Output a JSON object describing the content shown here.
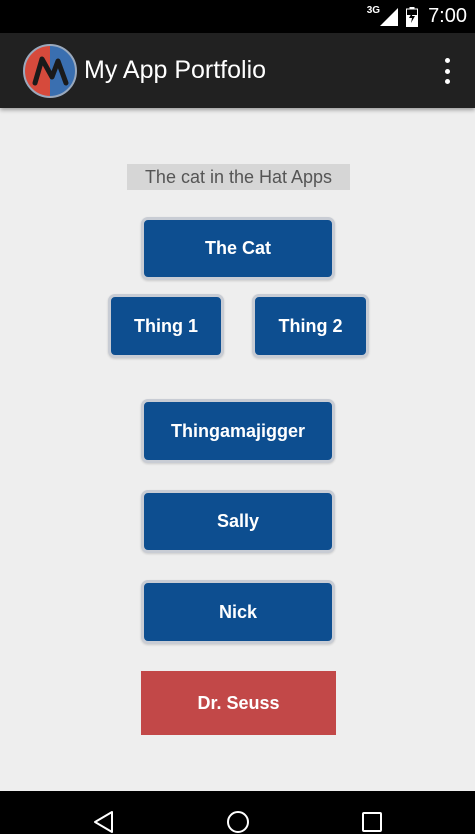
{
  "status_bar": {
    "network_type": "3G",
    "time": "7:00",
    "icons": [
      "signal-icon",
      "battery-icon"
    ]
  },
  "app_bar": {
    "title": "My App Portfolio",
    "logo_icon": "app-logo-icon",
    "menu_icon": "overflow-menu-icon"
  },
  "main": {
    "section_header": "The cat in the Hat Apps",
    "buttons": {
      "the_cat": "The Cat",
      "thing1": "Thing 1",
      "thing2": "Thing 2",
      "thingamajigger": "Thingamajigger",
      "sally": "Sally",
      "nick": "Nick",
      "dr_seuss": "Dr. Seuss"
    }
  },
  "nav_bar": {
    "icons": [
      "back-icon",
      "home-icon",
      "recent-apps-icon"
    ]
  },
  "colors": {
    "app_bar": "#212121",
    "button_blue": "#0d4e90",
    "button_red": "#c24848",
    "background": "#eeeeee"
  }
}
